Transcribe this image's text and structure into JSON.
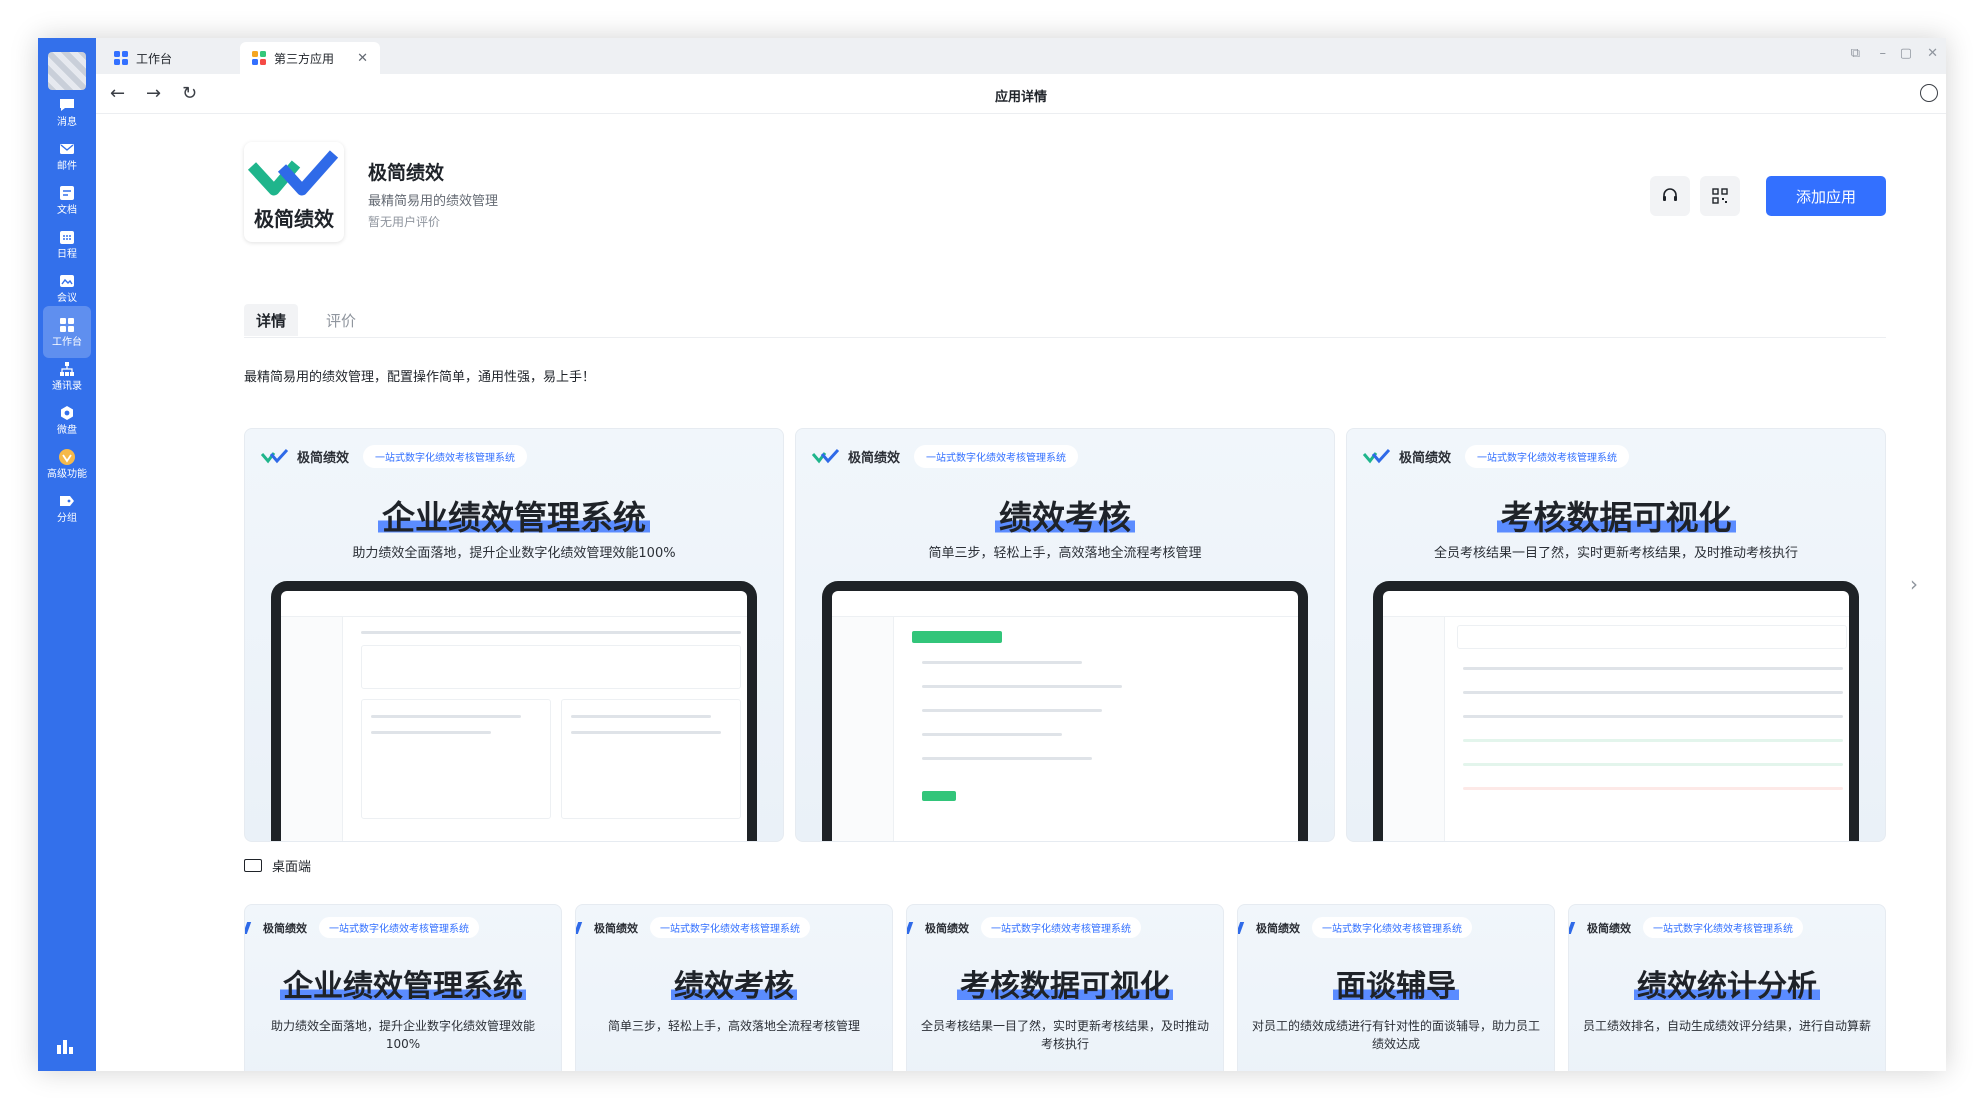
{
  "rail": {
    "items": [
      {
        "label": "消息",
        "icon": "chat-bubble-icon"
      },
      {
        "label": "邮件",
        "icon": "mail-icon"
      },
      {
        "label": "文档",
        "icon": "document-icon"
      },
      {
        "label": "日程",
        "icon": "calendar-icon"
      },
      {
        "label": "会议",
        "icon": "meeting-icon"
      },
      {
        "label": "工作台",
        "icon": "workbench-grid-icon"
      },
      {
        "label": "通讯录",
        "icon": "contacts-org-icon"
      },
      {
        "label": "微盘",
        "icon": "cloud-disk-icon"
      },
      {
        "label": "高级功能",
        "icon": "premium-badge-icon"
      },
      {
        "label": "分组",
        "icon": "folder-tag-icon"
      }
    ],
    "active": "工作台"
  },
  "tabs": [
    {
      "label": "工作台"
    },
    {
      "label": "第三方应用"
    }
  ],
  "nav": {
    "title": "应用详情"
  },
  "app": {
    "logo_text": "极简绩效",
    "name": "极简绩效",
    "subtitle": "最精简易用的绩效管理",
    "rating": "暂无用户评价",
    "add_button": "添加应用"
  },
  "detail_tabs": [
    "详情",
    "评价"
  ],
  "description": "最精简易用的绩效管理，配置操作简单，通用性强，易上手！",
  "cards": [
    {
      "brand": "极简绩效",
      "pill": "一站式数字化绩效考核管理系统",
      "title": "企业绩效管理系统",
      "subtitle": "助力绩效全面落地，提升企业数字化绩效管理效能100%"
    },
    {
      "brand": "极简绩效",
      "pill": "一站式数字化绩效考核管理系统",
      "title": "绩效考核",
      "subtitle": "简单三步，轻松上手，高效落地全流程考核管理"
    },
    {
      "brand": "极简绩效",
      "pill": "一站式数字化绩效考核管理系统",
      "title": "考核数据可视化",
      "subtitle": "全员考核结果一目了然，实时更新考核结果，及时推动考核执行"
    }
  ],
  "desktop_label": "桌面端",
  "small_cards": [
    {
      "brand": "极简绩效",
      "pill": "一站式数字化绩效考核管理系统",
      "title": "企业绩效管理系统",
      "subtitle": "助力绩效全面落地，提升企业数字化绩效管理效能100%"
    },
    {
      "brand": "极简绩效",
      "pill": "一站式数字化绩效考核管理系统",
      "title": "绩效考核",
      "subtitle": "简单三步，轻松上手，高效落地全流程考核管理"
    },
    {
      "brand": "极简绩效",
      "pill": "一站式数字化绩效考核管理系统",
      "title": "考核数据可视化",
      "subtitle": "全员考核结果一目了然，实时更新考核结果，及时推动考核执行"
    },
    {
      "brand": "极简绩效",
      "pill": "一站式数字化绩效考核管理系统",
      "title": "面谈辅导",
      "subtitle": "对员工的绩效成绩进行有针对性的面谈辅导，助力员工绩效达成"
    },
    {
      "brand": "极简绩效",
      "pill": "一站式数字化绩效考核管理系统",
      "title": "绩效统计分析",
      "subtitle": "员工绩效排名，自动生成绩效评分结果，进行自动算薪"
    }
  ],
  "colors": {
    "accent": "#3370ff",
    "rail": "#3370eb",
    "highlight": "#5b8cff",
    "brand_green": "#1fb58c",
    "brand_blue": "#2f6ae8"
  }
}
